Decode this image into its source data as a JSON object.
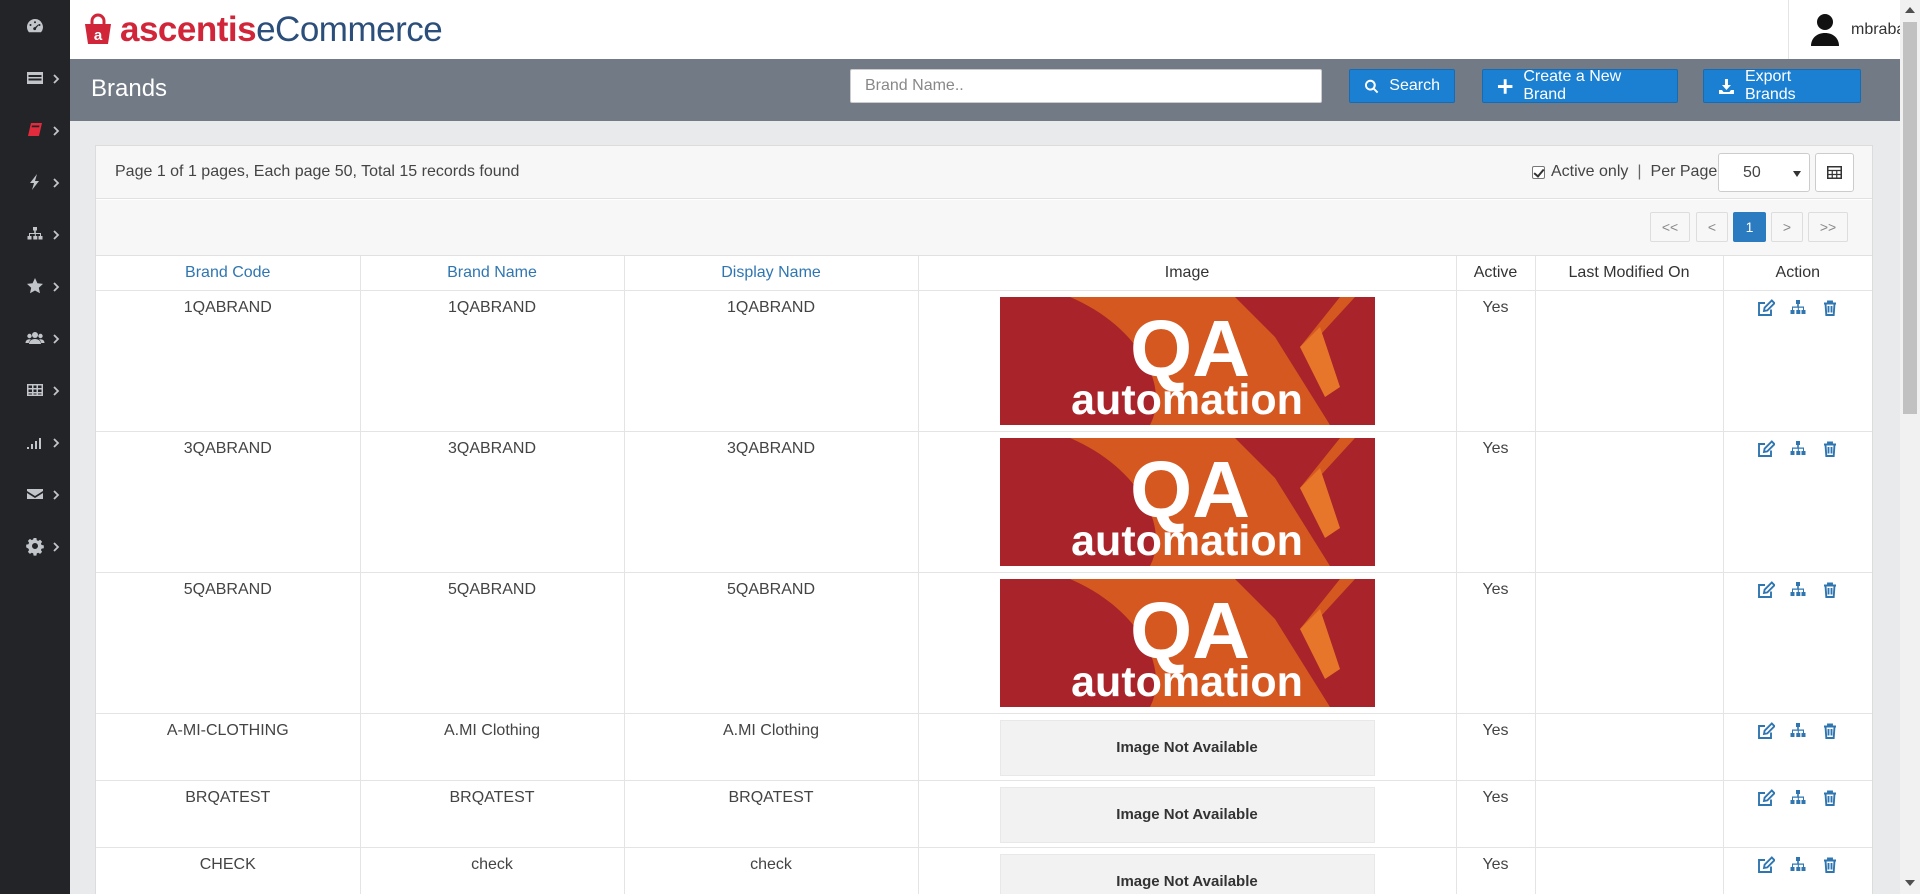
{
  "app": {
    "logo_brand": "ascentis",
    "logo_product": "eCommerce",
    "username": "mbrabante"
  },
  "sidebar": {
    "items": [
      {
        "icon": "dashboard-icon"
      },
      {
        "icon": "table-list-icon"
      },
      {
        "icon": "book-icon",
        "active": true
      },
      {
        "icon": "bolt-icon"
      },
      {
        "icon": "sitemap-icon"
      },
      {
        "icon": "star-icon"
      },
      {
        "icon": "users-icon"
      },
      {
        "icon": "grid-icon"
      },
      {
        "icon": "signal-icon"
      },
      {
        "icon": "envelope-icon"
      },
      {
        "icon": "gear-icon"
      }
    ]
  },
  "page": {
    "title": "Brands",
    "search_placeholder": "Brand Name..",
    "search_button": "Search",
    "create_button": "Create a New Brand",
    "export_button": "Export Brands"
  },
  "listing": {
    "summary": "Page 1 of 1 pages, Each page 50, Total 15 records found",
    "active_only_label": "Active only",
    "active_only_checked": true,
    "separator": "|",
    "per_page_label": "Per Page",
    "per_page_value": "50",
    "pagination": {
      "first": "<<",
      "prev": "<",
      "current": "1",
      "next": ">",
      "last": ">>"
    }
  },
  "table": {
    "columns": {
      "brand_code": "Brand Code",
      "brand_name": "Brand Name",
      "display_name": "Display Name",
      "image": "Image",
      "active": "Active",
      "last_modified": "Last Modified On",
      "action": "Action"
    },
    "image_top_text": "QA",
    "image_bottom_text": "automation",
    "no_image_text": "Image Not Available",
    "colors": {
      "image_red": "#a8232a",
      "image_orange": "#d4581f",
      "link_blue": "#2f76b1"
    },
    "rows": [
      {
        "code": "1QABRAND",
        "name": "1QABRAND",
        "display": "1QABRAND",
        "has_image": true,
        "active": "Yes",
        "modified": ""
      },
      {
        "code": "3QABRAND",
        "name": "3QABRAND",
        "display": "3QABRAND",
        "has_image": true,
        "active": "Yes",
        "modified": ""
      },
      {
        "code": "5QABRAND",
        "name": "5QABRAND",
        "display": "5QABRAND",
        "has_image": true,
        "active": "Yes",
        "modified": ""
      },
      {
        "code": "A-MI-CLOTHING",
        "name": "A.MI Clothing",
        "display": "A.MI Clothing",
        "has_image": false,
        "active": "Yes",
        "modified": ""
      },
      {
        "code": "BRQATEST",
        "name": "BRQATEST",
        "display": "BRQATEST",
        "has_image": false,
        "active": "Yes",
        "modified": ""
      },
      {
        "code": "CHECK",
        "name": "check",
        "display": "check",
        "has_image": false,
        "active": "Yes",
        "modified": ""
      }
    ]
  }
}
